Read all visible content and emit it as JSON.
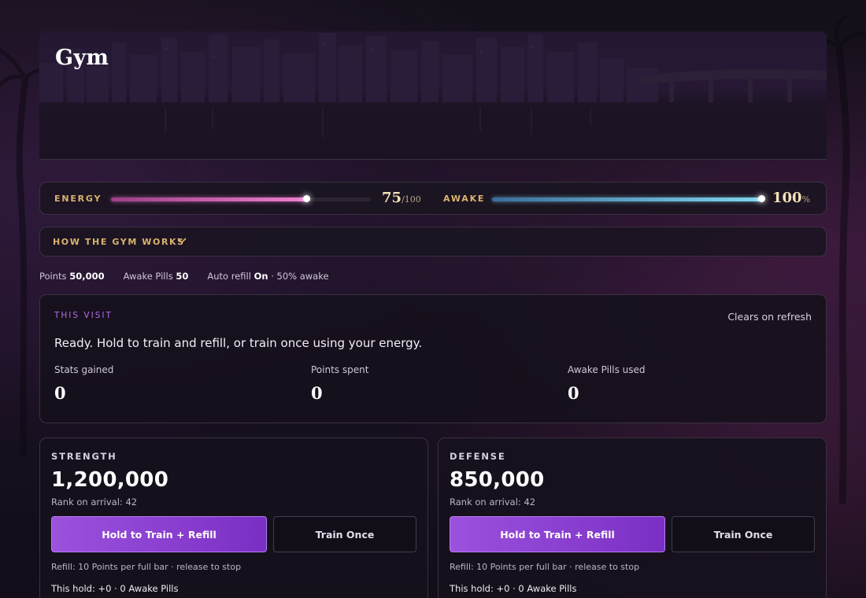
{
  "page": {
    "title": "Gym"
  },
  "meters": {
    "energy": {
      "label": "ENERGY",
      "value": "75",
      "max": "/100",
      "fraction": 0.75,
      "color": "#f07fd0"
    },
    "awake": {
      "label": "AWAKE",
      "value": "100",
      "unit": "%",
      "fraction": 1.0,
      "color": "#7fd6ee"
    }
  },
  "how_it_works": {
    "label": "HOW THE GYM WORKS"
  },
  "info": {
    "points_label": "Points",
    "points_value": "50,000",
    "pills_label": "Awake Pills",
    "pills_value": "50",
    "refill_label": "Auto refill",
    "refill_value": "On",
    "refill_suffix": "· 50% awake"
  },
  "visit": {
    "tag": "THIS VISIT",
    "clears": "Clears on refresh",
    "message": "Ready. Hold to train and refill, or train once using your energy.",
    "stats": [
      {
        "label": "Stats gained",
        "value": "0"
      },
      {
        "label": "Points spent",
        "value": "0"
      },
      {
        "label": "Awake Pills used",
        "value": "0"
      }
    ]
  },
  "cards": [
    {
      "title": "STRENGTH",
      "value": "1,200,000",
      "rank": "Rank on arrival: 42",
      "hold_button": "Hold to Train + Refill",
      "once_button": "Train Once",
      "refill_note": "Refill: 10 Points per full bar · release to stop",
      "hold_note": "This hold: +0 · 0 Awake Pills"
    },
    {
      "title": "DEFENSE",
      "value": "850,000",
      "rank": "Rank on arrival: 42",
      "hold_button": "Hold to Train + Refill",
      "once_button": "Train Once",
      "refill_note": "Refill: 10 Points per full bar · release to stop",
      "hold_note": "This hold: +0 · 0 Awake Pills"
    }
  ],
  "colors": {
    "accent_gold": "#d9b26e",
    "accent_purple": "#9c52dd",
    "visit_tag": "#b06ee8"
  }
}
